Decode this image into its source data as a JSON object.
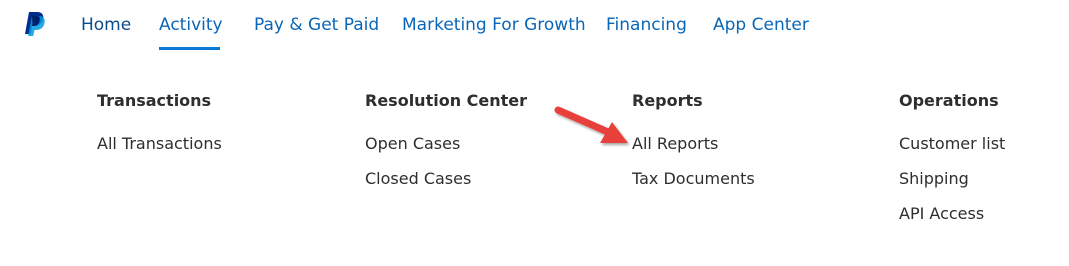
{
  "nav": {
    "items": [
      {
        "label": "Home"
      },
      {
        "label": "Activity"
      },
      {
        "label": "Pay & Get Paid"
      },
      {
        "label": "Marketing For Growth"
      },
      {
        "label": "Financing"
      },
      {
        "label": "App Center"
      }
    ],
    "active_item": "Activity"
  },
  "menu": {
    "columns": [
      {
        "heading": "Transactions",
        "links": [
          "All Transactions"
        ]
      },
      {
        "heading": "Resolution Center",
        "links": [
          "Open Cases",
          "Closed Cases"
        ]
      },
      {
        "heading": "Reports",
        "links": [
          "All Reports",
          "Tax Documents"
        ]
      },
      {
        "heading": "Operations",
        "links": [
          "Customer list",
          "Shipping",
          "API Access"
        ]
      }
    ]
  },
  "annotation": {
    "arrow_color": "#e8403a",
    "points_to": "All Reports"
  },
  "colors": {
    "nav_link": "#0a66b7",
    "nav_home": "#0b4c8c",
    "underline": "#0b78d4",
    "text": "#2c2e2f",
    "logo_dark": "#002c8a",
    "logo_light": "#009be1"
  }
}
